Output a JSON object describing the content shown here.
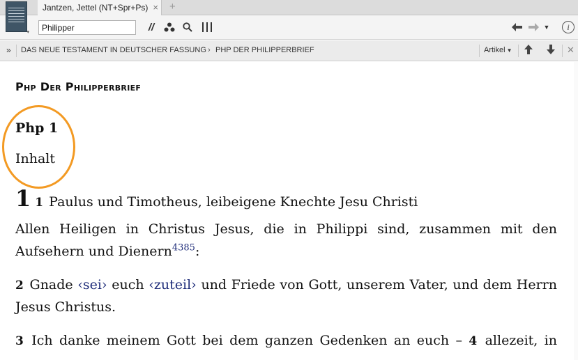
{
  "tab": {
    "title": "Jantzen, Jettel (NT+Spr+Ps)",
    "close": "×",
    "add": "+"
  },
  "toolbar": {
    "reference_value": "Philipper",
    "parallel": "//",
    "info": "i"
  },
  "breadcrumb": {
    "expand": "»",
    "items": [
      "DAS NEUE TESTAMENT IN DEUTSCHER FASSUNG",
      "PHP DER PHILIPPERBRIEF"
    ],
    "separator": "›",
    "view_menu": "Artikel"
  },
  "content": {
    "book_title": "Php Der Philipperbrief",
    "chapter_title": "Php 1",
    "section_title": "Inhalt",
    "chapter_number": "1",
    "verse1": {
      "num": "1",
      "line1": "Paulus und Timotheus, leibeigene Knechte Jesu Christi",
      "line2": "Allen Heiligen in Christus Jesus, die in Philippi sind, zusammen mit den",
      "line3_a": "Aufsehern und Dienern",
      "footnote": "4385",
      "line3_b": ":"
    },
    "verse2": {
      "num": "2",
      "a": "Gnade ",
      "add1": "‹sei›",
      "b": " euch ",
      "add2": "‹zuteil›",
      "c": " und Friede von Gott, unserem Vater, und dem Herrn",
      "line2": "Jesus Christus."
    },
    "verse3": {
      "num": "3",
      "a": "Ich danke meinem Gott bei dem ganzen Gedenken an euch – ",
      "num4": "4",
      "b": "allezeit, in"
    }
  }
}
